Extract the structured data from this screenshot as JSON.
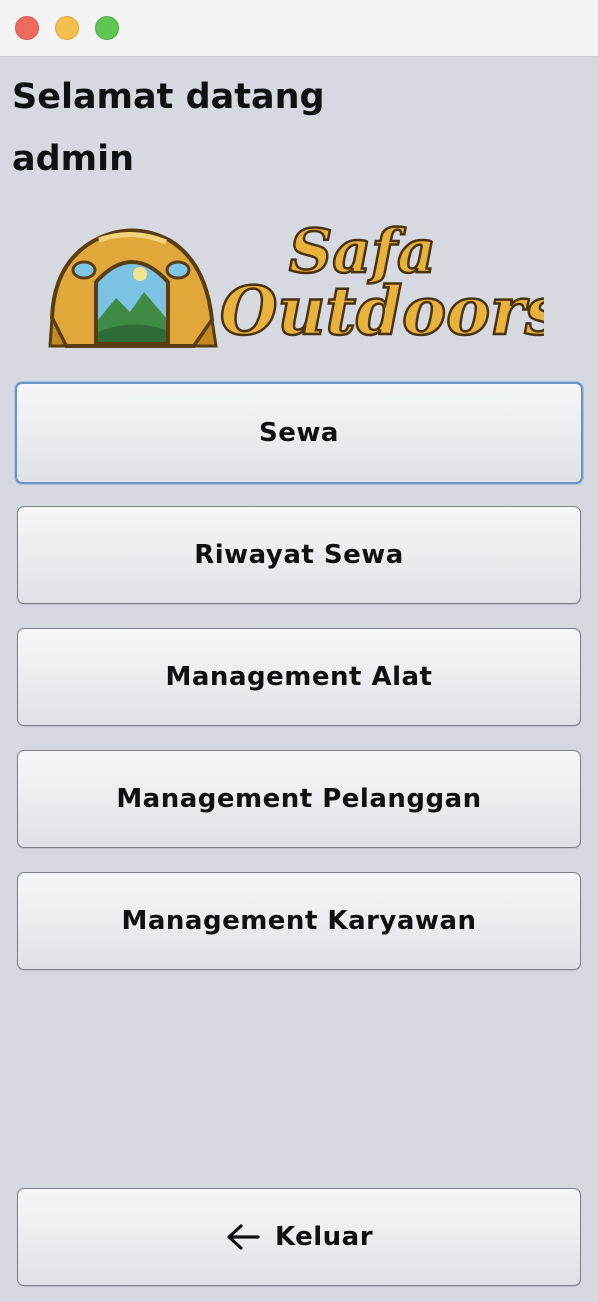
{
  "window": {
    "controls": [
      "close",
      "minimize",
      "maximize"
    ]
  },
  "greeting": "Selamat datang admin",
  "logo": {
    "text_line1": "Safa",
    "text_line2": "Outdoors",
    "icon": "tent-icon"
  },
  "menu": {
    "sewa": "Sewa",
    "riwayat_sewa": "Riwayat Sewa",
    "management_alat": "Management Alat",
    "management_pelanggan": "Management Pelanggan",
    "management_karyawan": "Management Karyawan"
  },
  "logout": {
    "label": "Keluar",
    "icon": "arrow-left-icon"
  },
  "colors": {
    "window_bg": "#d6d9e0",
    "focus_ring": "#6b93c4",
    "logo_gold": "#e8b23c"
  }
}
